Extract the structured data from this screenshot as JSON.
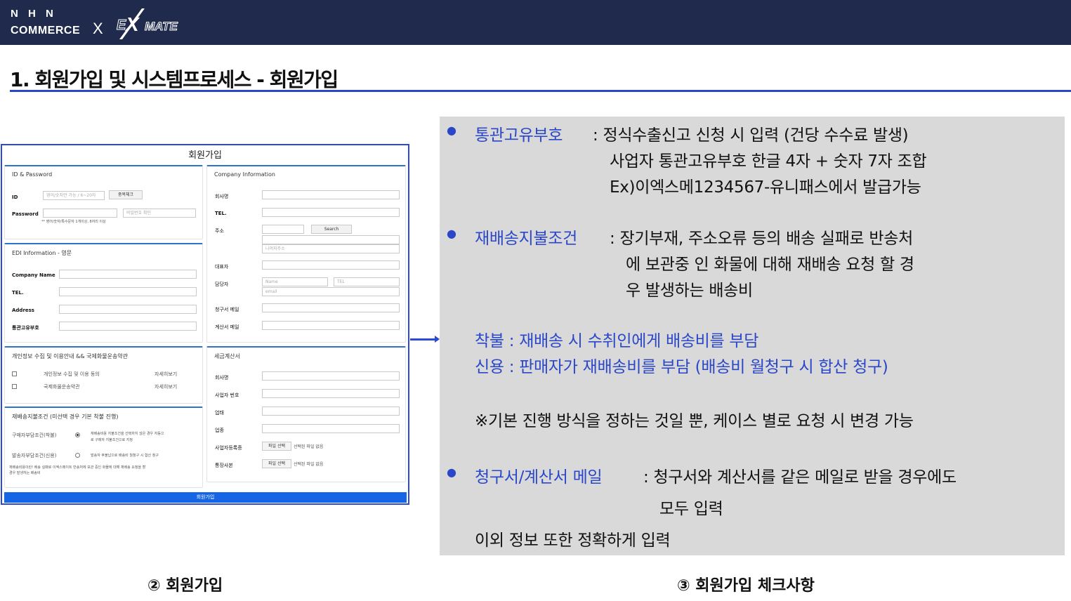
{
  "header": {
    "brand_top": "N H N",
    "brand_bottom": "COMMERCE",
    "brand_x": "X",
    "partner_logo_text": "EXMATE",
    "bar_color": "#1f2a4d"
  },
  "section_title": "1. 회원가입 및 시스템프로세스 - 회원가입",
  "form": {
    "title": "회원가입",
    "id_panel": {
      "title": "ID & Password",
      "id_label": "ID",
      "id_placeholder": "영어/숫자만 가능 / 6~20자",
      "dup_check": "중복체크",
      "password_label": "Password",
      "password_confirm_placeholder": "비밀번호 확인",
      "password_hint": "** 영어/숫자/특수문자 1개이상, 8자리 이상"
    },
    "edi_panel": {
      "title": "EDI Information - 영문",
      "company_name_label": "Company Name",
      "tel_label": "TEL.",
      "address_label": "Address",
      "customs_label": "통관고유부호"
    },
    "company_panel": {
      "title": "Company Information",
      "company_label": "회사명",
      "tel_label": "TEL.",
      "address_label": "주소",
      "search_button": "Search",
      "detail_address_placeholder": "나머지주소",
      "ceo_label": "대표자",
      "manager_label": "담당자",
      "name_placeholder": "Name",
      "tel_placeholder": "TEL",
      "email_placeholder": "email",
      "bill_mail_label": "청구서 메일",
      "invoice_mail_label": "계산서 메일"
    },
    "privacy_panel": {
      "title": "개인정보 수집 및 이용안내 && 국제화물운송약관",
      "item1": "개인정보 수집 및 이용 동의",
      "item2": "국제화물운송약관",
      "detail1": "자세히보기",
      "detail2": "자세히보기"
    },
    "tax_panel": {
      "title": "세금계산서",
      "company_label": "회사명",
      "bizno_label": "사업자 번호",
      "biztype_label": "업태",
      "bizitem_label": "업종",
      "bizreg_label": "사업자등록증",
      "bankbook_label": "통장사본",
      "file_button": "파일 선택",
      "no_file": "선택된 파일 없음"
    },
    "reship_panel": {
      "title": "재배송지불조건 (미선택 경우 기본 착불 진행)",
      "buyer_label": "구매자부담조건(착불)",
      "buyer_desc_1": "재배송비용 지불조건을 선택하지 않은 경우 자동으",
      "buyer_desc_2": "로 구매자 지불조건으로 지정",
      "seller_label": "발송자부담조건(신용)",
      "seller_desc": "발송자 후불납으로 배송비 월청구 시 합산 청구",
      "note_1": "재배송비용이란! 배송 실패로 이엑스메이트 반송처에 보관 중인 화물에 대해 재배송 요청을 할",
      "note_2": "경우 발생하는 배송비"
    },
    "submit": "회원가입",
    "accent_color": "#2c4ad6"
  },
  "checklist": {
    "customs": {
      "label": "통관고유부호",
      "line1": ": 정식수출신고 신청 시 입력 (건당 수수료 발생)",
      "line2": "사업자 통관고유부호 한글 4자 + 숫자 7자 조합",
      "line3": "Ex)이엑스메1234567-유니패스에서 발급가능"
    },
    "reship": {
      "label": "재배송지불조건",
      "line1": ": 장기부재, 주소오류 등의 배송 실패로 반송처",
      "line2": "에 보관중  인 화물에 대해 재배송 요청 할 경",
      "line3": "우 발생하는 배송비"
    },
    "cod_line": "착불 : 재배송 시 수취인에게 배송비를 부담",
    "credit_line": "신용 : 판매자가 재배송비를 부담 (배송비 월청구 시 합산 청구)",
    "note": "※기본 진행 방식을 정하는 것일 뿐, 케이스 별로 요청 시 변경 가능",
    "mail": {
      "label": "청구서/계산서 메일",
      "line1": ": 청구서와 계산서를 같은 메일로 받을 경우에도",
      "line2": "모두  입력",
      "line3": "이외 정보 또한 정확하게 입력"
    },
    "highlight_color": "#2b47c9",
    "panel_color": "#d9d9d9"
  },
  "captions": {
    "left": "② 회원가입",
    "right": "③ 회원가입 체크사항"
  }
}
